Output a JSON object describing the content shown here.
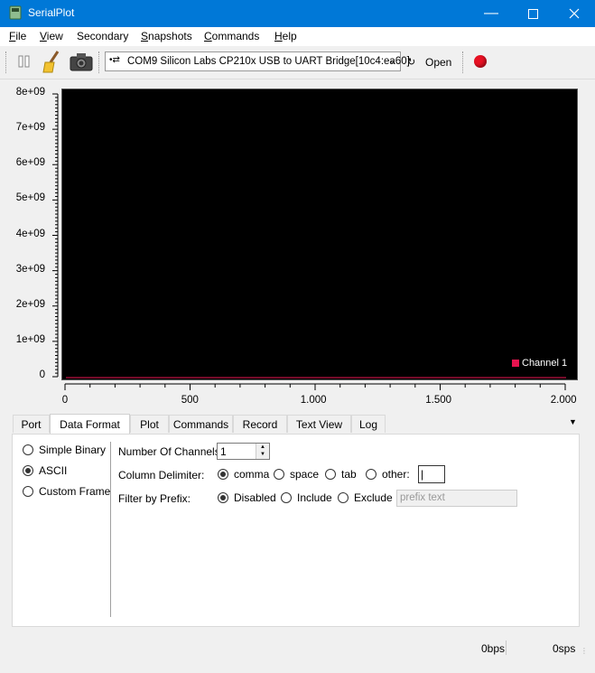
{
  "window": {
    "title": "SerialPlot"
  },
  "menu": [
    {
      "label": "File",
      "key": "F",
      "rest": "ile"
    },
    {
      "label": "View",
      "key": "V",
      "rest": "iew"
    },
    {
      "label": "Secondary",
      "key": "",
      "rest": "Secondary"
    },
    {
      "label": "Snapshots",
      "key": "S",
      "rest": "napshots"
    },
    {
      "label": "Commands",
      "key": "C",
      "rest": "ommands"
    },
    {
      "label": "Help",
      "key": "H",
      "rest": "elp"
    }
  ],
  "toolbar": {
    "port": "COM9 Silicon Labs CP210x USB to UART Bridge[10c4:ea60]",
    "open_label": "Open",
    "record_color": "#e81123"
  },
  "plot": {
    "y_ticks": [
      "8e+09",
      "7e+09",
      "6e+09",
      "5e+09",
      "4e+09",
      "3e+09",
      "2e+09",
      "1e+09",
      "0"
    ],
    "x_ticks": [
      "0",
      "500",
      "1.000",
      "1.500",
      "2.000"
    ],
    "legend": "Channel 1",
    "series_color": "#e8134f"
  },
  "chart_data": {
    "type": "line",
    "series": [
      {
        "name": "Channel 1",
        "values": [
          0,
          0
        ]
      }
    ],
    "x": [
      0,
      2000
    ],
    "xlim": [
      0,
      2000
    ],
    "ylim": [
      0,
      8000000000
    ],
    "legend": "bottom-right"
  },
  "tabs": [
    "Port",
    "Data Format",
    "Plot",
    "Commands",
    "Record",
    "Text View",
    "Log"
  ],
  "active_tab": "Data Format",
  "format": {
    "options": [
      "Simple Binary",
      "ASCII",
      "Custom Frame"
    ],
    "selected": "ASCII",
    "channels_label": "Number Of Channels:",
    "channels_value": "1",
    "delimiter_label": "Column Delimiter:",
    "delimiters": [
      "comma",
      "space",
      "tab",
      "other:"
    ],
    "delimiter_selected": "comma",
    "other_value": "|",
    "prefix_label": "Filter by Prefix:",
    "prefix_modes": [
      "Disabled",
      "Include",
      "Exclude"
    ],
    "prefix_selected": "Disabled",
    "prefix_placeholder": "prefix text"
  },
  "status": {
    "bps": "0bps",
    "sps": "0sps"
  }
}
